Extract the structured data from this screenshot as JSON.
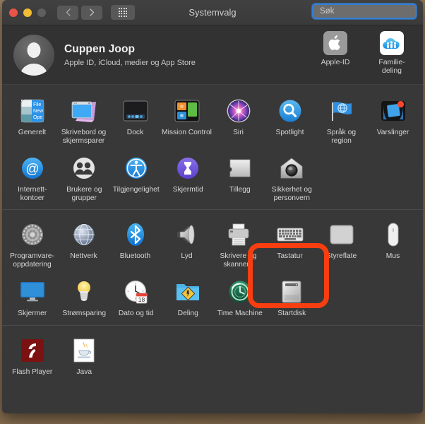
{
  "window": {
    "title": "Systemvalg",
    "traffic_lights": [
      "close",
      "minimize",
      "zoom"
    ],
    "nav_back": "‹",
    "nav_forward": "›",
    "grid_button": "show-all-grid-icon"
  },
  "search": {
    "placeholder": "Søk",
    "value": "",
    "icon": "search-icon"
  },
  "account": {
    "name": "Cuppen Joop",
    "subtitle": "Apple ID, iCloud, medier og App Store",
    "avatar": "user-avatar-placeholder",
    "buttons": [
      {
        "label": "Apple-ID",
        "icon": "apple-logo-icon"
      },
      {
        "label": "Familie-\ndeling",
        "label_line1": "Familie-",
        "label_line2": "deling",
        "icon": "family-sharing-icon"
      }
    ]
  },
  "sections": [
    {
      "name": "main",
      "rows": [
        [
          {
            "label": "Generelt",
            "icon": "general-icon"
          },
          {
            "label": "Skrivebord og skjermsparer",
            "icon": "desktop-screensaver-icon"
          },
          {
            "label": "Dock",
            "icon": "dock-icon"
          },
          {
            "label": "Mission Control",
            "icon": "mission-control-icon"
          },
          {
            "label": "Siri",
            "icon": "siri-icon"
          },
          {
            "label": "Spotlight",
            "icon": "spotlight-icon"
          },
          {
            "label": "Språk og region",
            "icon": "language-region-icon"
          },
          {
            "label": "Varslinger",
            "icon": "notifications-icon"
          }
        ],
        [
          {
            "label": "Internett-kontoer",
            "icon": "internet-accounts-icon"
          },
          {
            "label": "Brukere og grupper",
            "icon": "users-groups-icon"
          },
          {
            "label": "Tilgjengelighet",
            "icon": "accessibility-icon"
          },
          {
            "label": "Skjermtid",
            "icon": "screen-time-icon"
          },
          {
            "label": "Tillegg",
            "icon": "extensions-icon"
          },
          {
            "label": "Sikkerhet og personvern",
            "icon": "security-privacy-icon",
            "highlighted": true
          }
        ]
      ]
    },
    {
      "name": "hardware",
      "rows": [
        [
          {
            "label": "Programvare-oppdatering",
            "icon": "software-update-icon"
          },
          {
            "label": "Nettverk",
            "icon": "network-icon"
          },
          {
            "label": "Bluetooth",
            "icon": "bluetooth-icon"
          },
          {
            "label": "Lyd",
            "icon": "sound-icon"
          },
          {
            "label": "Skrivere og skannere",
            "icon": "printers-scanners-icon"
          },
          {
            "label": "Tastatur",
            "icon": "keyboard-icon"
          },
          {
            "label": "Styreflate",
            "icon": "trackpad-icon"
          },
          {
            "label": "Mus",
            "icon": "mouse-icon"
          }
        ],
        [
          {
            "label": "Skjermer",
            "icon": "displays-icon"
          },
          {
            "label": "Strømsparing",
            "icon": "energy-saver-icon"
          },
          {
            "label": "Dato og tid",
            "icon": "date-time-icon"
          },
          {
            "label": "Deling",
            "icon": "sharing-icon"
          },
          {
            "label": "Time Machine",
            "icon": "time-machine-icon"
          },
          {
            "label": "Startdisk",
            "icon": "startup-disk-icon"
          }
        ]
      ]
    },
    {
      "name": "third-party",
      "rows": [
        [
          {
            "label": "Flash Player",
            "icon": "flash-player-icon"
          },
          {
            "label": "Java",
            "icon": "java-icon"
          }
        ]
      ]
    }
  ],
  "highlight": {
    "target": "Sikkerhet og personvern",
    "color": "#f63e10",
    "shape": "rounded-rectangle"
  },
  "colors": {
    "window_bg": "#383838",
    "titlebar_bg": "#3d3d3d",
    "text_primary": "#f2f2f2",
    "text_secondary": "#c8c8c8",
    "focus_ring": "#2f7fd8",
    "highlight": "#f63e10"
  }
}
